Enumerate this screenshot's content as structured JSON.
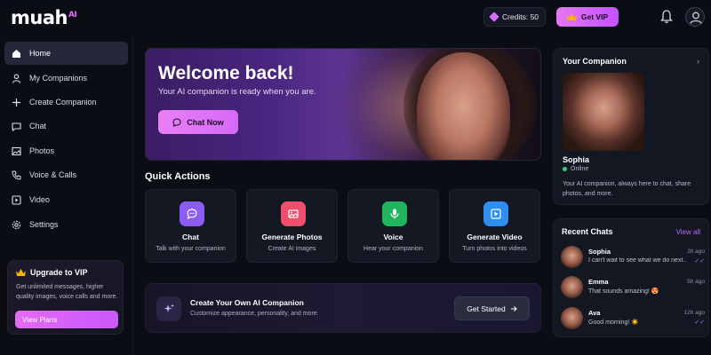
{
  "header": {
    "logo_text": "muah",
    "logo_suffix": "AI",
    "credits_label": "Credits: 50",
    "get_vip_label": "Get VIP"
  },
  "sidebar": {
    "items": [
      {
        "label": "Home",
        "icon": "home-icon",
        "active": true
      },
      {
        "label": "My Companions",
        "icon": "person-icon"
      },
      {
        "label": "Create Companion",
        "icon": "plus-icon"
      },
      {
        "label": "Chat",
        "icon": "chat-icon"
      },
      {
        "label": "Photos",
        "icon": "image-icon"
      },
      {
        "label": "Voice & Calls",
        "icon": "phone-icon"
      },
      {
        "label": "Video",
        "icon": "video-icon"
      },
      {
        "label": "Settings",
        "icon": "gear-icon"
      }
    ],
    "vip": {
      "title": "Upgrade to VIP",
      "description": "Get unlimited messages, higher quality images, voice calls and more.",
      "button": "View Plans"
    }
  },
  "hero": {
    "title": "Welcome back!",
    "subtitle": "Your AI companion is ready when you are.",
    "button": "Chat Now"
  },
  "quick_actions": {
    "title": "Quick Actions",
    "items": [
      {
        "title": "Chat",
        "desc": "Talk with your companion",
        "icon": "chat-bubble-icon",
        "color": "#8b5cf6"
      },
      {
        "title": "Generate Photos",
        "desc": "Create AI images",
        "icon": "image-icon",
        "color": "#ef4f6b"
      },
      {
        "title": "Voice",
        "desc": "Hear your companion",
        "icon": "microphone-icon",
        "color": "#22b35e"
      },
      {
        "title": "Generate Video",
        "desc": "Turn photos into videos",
        "icon": "play-icon",
        "color": "#2f8ff0"
      }
    ]
  },
  "create_banner": {
    "title": "Create Your Own AI Companion",
    "desc": "Customize appearance, personality, and more.",
    "button": "Get Started"
  },
  "companion": {
    "title": "Your Companion",
    "name": "Sophia",
    "status": "Online",
    "description": "Your AI companion, always here to chat, share photos, and more."
  },
  "recent_chats": {
    "title": "Recent Chats",
    "view_all": "View all",
    "items": [
      {
        "name": "Sophia",
        "message": "I can't wait to see what we do next...",
        "time": "2h ago",
        "read": true
      },
      {
        "name": "Emma",
        "message": "That sounds amazing! 😍",
        "time": "5h ago",
        "read": false
      },
      {
        "name": "Ava",
        "message": "Good morning! ☀️",
        "time": "12h ago",
        "read": true
      }
    ]
  },
  "colors": {
    "accent": "#d66af8",
    "background": "#0b0d14",
    "online": "#35d07f"
  }
}
